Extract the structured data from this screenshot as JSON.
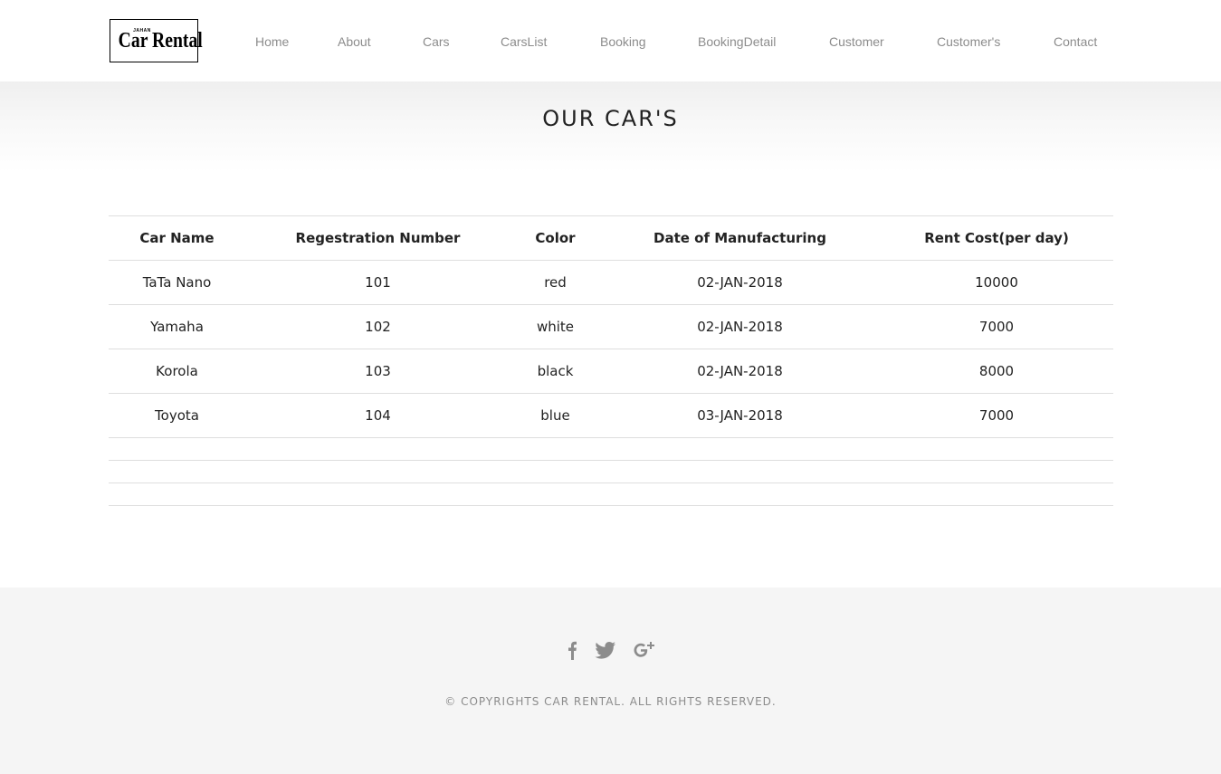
{
  "brand": {
    "small_text": "JAHAN",
    "name": "Car Rental"
  },
  "nav": {
    "items": [
      {
        "label": "Home"
      },
      {
        "label": "About"
      },
      {
        "label": "Cars"
      },
      {
        "label": "CarsList"
      },
      {
        "label": "Booking"
      },
      {
        "label": "BookingDetail"
      },
      {
        "label": "Customer"
      },
      {
        "label": "Customer's"
      },
      {
        "label": "Contact"
      }
    ]
  },
  "page": {
    "title": "OUR CAR'S"
  },
  "table": {
    "columns": [
      "Car Name",
      "Regestration Number",
      "Color",
      "Date of Manufacturing",
      "Rent Cost(per day)"
    ],
    "rows": [
      [
        "TaTa Nano",
        "101",
        "red",
        "02-JAN-2018",
        "10000"
      ],
      [
        "Yamaha",
        "102",
        "white",
        "02-JAN-2018",
        "7000"
      ],
      [
        "Korola",
        "103",
        "black",
        "02-JAN-2018",
        "8000"
      ],
      [
        "Toyota",
        "104",
        "blue",
        "03-JAN-2018",
        "7000"
      ]
    ]
  },
  "footer": {
    "social_icons": [
      "facebook-icon",
      "twitter-icon",
      "google-plus-icon"
    ],
    "copyright": "© COPYRIGHTS CAR RENTAL. ALL RIGHTS RESERVED."
  },
  "colors": {
    "nav_text": "#8c8c8c",
    "footer_bg": "#f5f5f5",
    "icon": "#8c8c8c"
  }
}
